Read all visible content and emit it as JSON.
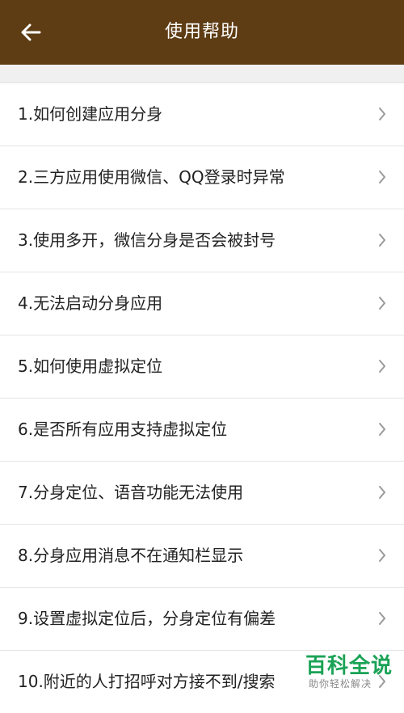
{
  "header": {
    "title": "使用帮助",
    "back_icon": "arrow-left-icon",
    "background": "#5e3c14"
  },
  "list": {
    "items": [
      {
        "label": "1.如何创建应用分身"
      },
      {
        "label": "2.三方应用使用微信、QQ登录时异常"
      },
      {
        "label": "3.使用多开，微信分身是否会被封号"
      },
      {
        "label": "4.无法启动分身应用"
      },
      {
        "label": "5.如何使用虚拟定位"
      },
      {
        "label": "6.是否所有应用支持虚拟定位"
      },
      {
        "label": "7.分身定位、语音功能无法使用"
      },
      {
        "label": "8.分身应用消息不在通知栏显示"
      },
      {
        "label": "9.设置虚拟定位后，分身定位有偏差"
      },
      {
        "label": "10.附近的人打招呼对方接不到/搜索"
      }
    ],
    "chevron_icon": "chevron-right-icon"
  },
  "watermark": {
    "main": "百科全说",
    "sub": "助你轻松解决",
    "color": "#1aa356"
  }
}
